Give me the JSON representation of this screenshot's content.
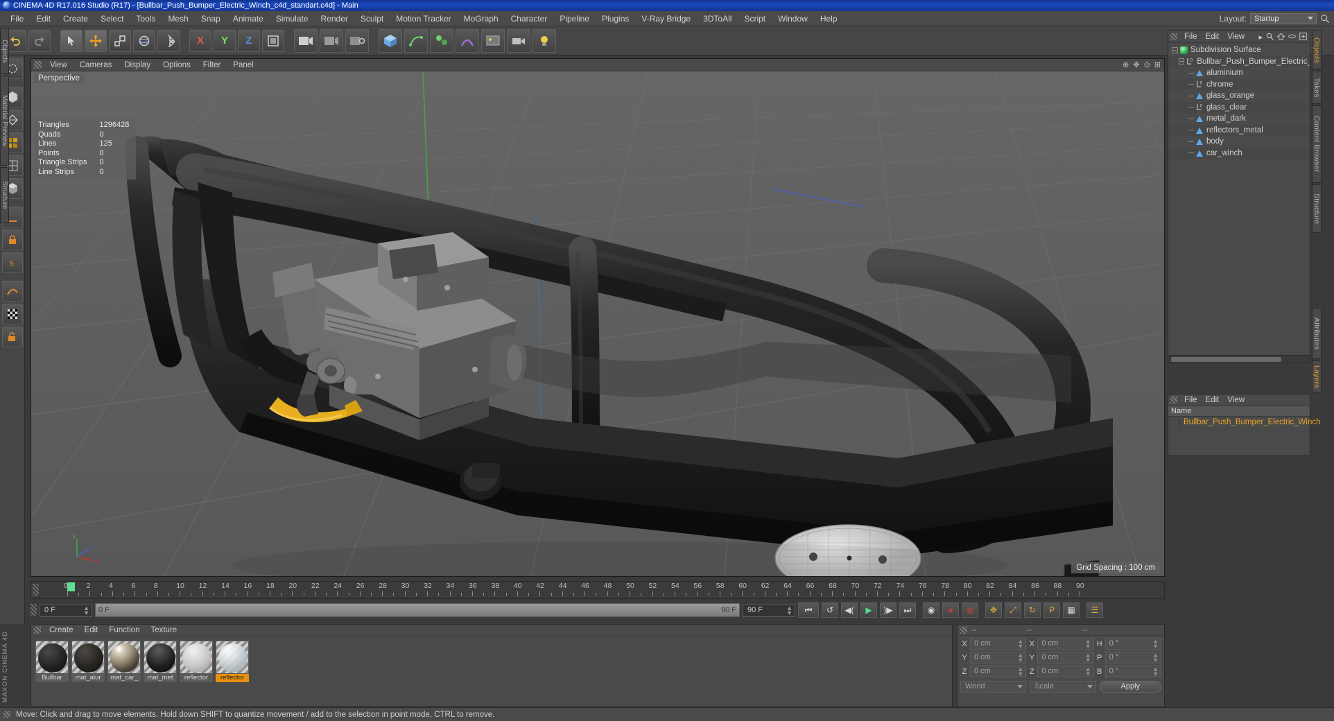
{
  "window": {
    "title": "CINEMA 4D R17.016 Studio (R17) - [Bullbar_Push_Bumper_Electric_Winch_c4d_standart.c4d] - Main",
    "logo_icon": "c4d-logo-icon"
  },
  "menubar": {
    "items": [
      "File",
      "Edit",
      "Create",
      "Select",
      "Tools",
      "Mesh",
      "Snap",
      "Animate",
      "Simulate",
      "Render",
      "Sculpt",
      "Motion Tracker",
      "MoGraph",
      "Character",
      "Pipeline",
      "Plugins",
      "V-Ray Bridge",
      "3DToAll",
      "Script",
      "Window",
      "Help"
    ],
    "layout_label": "Layout:",
    "layout_value": "Startup"
  },
  "viewport": {
    "menu": [
      "View",
      "Cameras",
      "Display",
      "Options",
      "Filter",
      "Panel"
    ],
    "label": "Perspective",
    "grid_spacing": "Grid Spacing : 100 cm",
    "stats": [
      {
        "name": "Triangles",
        "value": "1296428"
      },
      {
        "name": "Quads",
        "value": "0"
      },
      {
        "name": "Lines",
        "value": "125"
      },
      {
        "name": "Points",
        "value": "0"
      },
      {
        "name": "Triangle Strips",
        "value": "0"
      },
      {
        "name": "Line Strips",
        "value": "0"
      }
    ],
    "axis": {
      "x": "X",
      "y": "Y",
      "z": "Z"
    }
  },
  "timeline": {
    "ticks": [
      0,
      2,
      4,
      6,
      8,
      10,
      12,
      14,
      16,
      18,
      20,
      22,
      24,
      26,
      28,
      30,
      32,
      34,
      36,
      38,
      40,
      42,
      44,
      46,
      48,
      50,
      52,
      54,
      56,
      58,
      60,
      62,
      64,
      66,
      68,
      70,
      72,
      74,
      76,
      78,
      80,
      82,
      84,
      86,
      88,
      90
    ],
    "current_frame_small": "0 F",
    "start_field": "0 F",
    "range_start": "0 F",
    "range_end": "90 F",
    "end_field": "90 F",
    "playhead_frame": 0
  },
  "materials": {
    "menu": [
      "Create",
      "Edit",
      "Function",
      "Texture"
    ],
    "items": [
      {
        "name": "Bullbar",
        "color": "#2a2a2a",
        "selected": false
      },
      {
        "name": "mat_alur",
        "color": "#2e2c2a",
        "selected": false
      },
      {
        "name": "mat_car_",
        "color": "#8f8675",
        "selected": false
      },
      {
        "name": "mat_met",
        "color": "#1f1f1f",
        "selected": false
      },
      {
        "name": "reflector",
        "color": "#c9c9c9",
        "selected": false
      },
      {
        "name": "reflector",
        "color": "#d8dde0",
        "selected": true
      }
    ]
  },
  "coordinates": {
    "header": [
      "--",
      "--",
      "--"
    ],
    "rows": [
      {
        "l1": "X",
        "v1": "0 cm",
        "l2": "X",
        "v2": "0 cm",
        "l3": "H",
        "v3": "0 °"
      },
      {
        "l1": "Y",
        "v1": "0 cm",
        "l2": "Y",
        "v2": "0 cm",
        "l3": "P",
        "v3": "0 °"
      },
      {
        "l1": "Z",
        "v1": "0 cm",
        "l2": "Z",
        "v2": "0 cm",
        "l3": "B",
        "v3": "0 °"
      }
    ],
    "system": "World",
    "mode": "Scale",
    "apply": "Apply"
  },
  "object_manager": {
    "menu": [
      "File",
      "Edit",
      "View"
    ],
    "icons": [
      "search-icon",
      "home-icon",
      "eye-icon",
      "add-icon"
    ],
    "tree": [
      {
        "label": "Subdivision Surface",
        "icon": "subdivision-surface-icon",
        "depth": 0,
        "expander": true
      },
      {
        "label": "Bullbar_Push_Bumper_Electric_Win",
        "icon": "null-object-icon",
        "depth": 1,
        "expander": true
      },
      {
        "label": "aluminium",
        "icon": "polygon-object-icon",
        "depth": 2,
        "expander": false
      },
      {
        "label": "chrome",
        "icon": "null-object-icon",
        "depth": 2,
        "expander": false
      },
      {
        "label": "glass_orange",
        "icon": "polygon-object-icon",
        "depth": 2,
        "expander": false
      },
      {
        "label": "glass_clear",
        "icon": "null-object-icon",
        "depth": 2,
        "expander": false
      },
      {
        "label": "metal_dark",
        "icon": "polygon-object-icon",
        "depth": 2,
        "expander": false
      },
      {
        "label": "reflectors_metal",
        "icon": "polygon-object-icon",
        "depth": 2,
        "expander": false
      },
      {
        "label": "body",
        "icon": "polygon-object-icon",
        "depth": 2,
        "expander": false
      },
      {
        "label": "car_winch",
        "icon": "polygon-object-icon",
        "depth": 2,
        "expander": false
      }
    ]
  },
  "layer_manager": {
    "menu": [
      "File",
      "Edit",
      "View"
    ],
    "column_header": "Name",
    "rows": [
      {
        "label": "Bullbar_Push_Bumper_Electric_Winch",
        "color": "#6a2f8c"
      }
    ]
  },
  "right_tabs": [
    {
      "label": "Objects",
      "active": true
    },
    {
      "label": "Takes",
      "active": false
    },
    {
      "label": "Content Browser",
      "active": false
    },
    {
      "label": "Structure",
      "active": false
    }
  ],
  "right_tabs_lower": [
    {
      "label": "Attributes",
      "active": false
    },
    {
      "label": "Layers",
      "active": true
    }
  ],
  "left_tabs": [
    "Objects",
    "Material Preview",
    "Structure"
  ],
  "statusbar": {
    "text": "Move: Click and drag to move elements. Hold down SHIFT to quantize movement / add to the selection in point mode, CTRL to remove."
  },
  "branding": "MAXON CINEMA 4D",
  "toolbar": {
    "buttons": [
      "undo-icon",
      "redo-icon",
      "select-tool-icon",
      "move-tool-icon",
      "scale-tool-icon",
      "rotate-tool-icon",
      "magnet-icon",
      "axis-x-icon",
      "axis-y-icon",
      "axis-z-icon",
      "world-coord-icon",
      "render-view-icon",
      "render-region-icon",
      "render-settings-icon",
      "cube-primitive-icon",
      "spline-pen-icon",
      "mograph-icon",
      "deformer-icon",
      "environment-icon",
      "camera-icon",
      "light-icon"
    ]
  },
  "left_tools": [
    "live-selection-icon",
    "box-cube-icon",
    "mesh-icon",
    "array-icon",
    "subdivide-icon",
    "extrude-icon",
    "ruler-icon",
    "lock-icon",
    "snap-icon",
    "deform-icon",
    "texture-icon",
    "safe-frame-icon"
  ],
  "colors": {
    "accent_orange": "#e8a32a",
    "titlebar_blue": "#1b49c1",
    "play_green": "#4fdc8a",
    "record_red": "#d23b3b",
    "panel_bg": "#4a4a4a",
    "viewport_bg": "#5f5f5f"
  }
}
